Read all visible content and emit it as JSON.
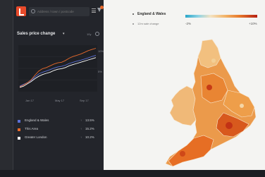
{
  "search": {
    "placeholder": "Address / town / postcode"
  },
  "panel": {
    "title": "Sales price change",
    "chevron": "▾",
    "range": "10y"
  },
  "chart_data": {
    "type": "line",
    "x": [
      0,
      1,
      2,
      3,
      4,
      5,
      6,
      7,
      8,
      9,
      10,
      11,
      12,
      13,
      14,
      15,
      16,
      17,
      18,
      19,
      20
    ],
    "x_tick_labels": [
      "Jan 17",
      "May 17",
      "Sep 17"
    ],
    "y_tick_labels": [
      "10%",
      "5%"
    ],
    "series": [
      {
        "name": "England & Wales",
        "color": "#5b6fd6",
        "values": [
          0.4,
          1.0,
          1.6,
          2.4,
          3.6,
          4.6,
          5.2,
          5.6,
          6.1,
          6.6,
          7.0,
          7.2,
          7.6,
          8.2,
          8.6,
          9.0,
          9.3,
          9.7,
          10.1,
          10.6,
          11.0
        ]
      },
      {
        "name": "This Area",
        "color": "#e8692a",
        "values": [
          0.2,
          0.8,
          1.6,
          2.6,
          4.2,
          5.6,
          6.4,
          6.8,
          7.4,
          8.0,
          8.4,
          8.6,
          9.2,
          10.0,
          10.6,
          11.0,
          11.4,
          12.0,
          12.6,
          13.0,
          13.4
        ]
      },
      {
        "name": "Greater London",
        "color": "#ffffff",
        "values": [
          0.0,
          0.4,
          1.2,
          2.0,
          3.0,
          3.8,
          4.4,
          4.8,
          5.2,
          5.8,
          6.2,
          6.4,
          6.8,
          7.4,
          7.8,
          8.2,
          8.6,
          9.0,
          9.4,
          9.8,
          10.2
        ]
      }
    ],
    "ylim": [
      -1,
      14
    ]
  },
  "legend": [
    {
      "name": "England & Wales",
      "arrow": "↑",
      "value": "13.5%",
      "color": "#5b6fd6"
    },
    {
      "name": "This Area",
      "arrow": "↑",
      "value": "15.2%",
      "color": "#e8692a"
    },
    {
      "name": "Greater London",
      "arrow": "↑",
      "value": "10.2%",
      "color": "#ffffff"
    }
  ],
  "map_legend": {
    "title": "England & Wales",
    "subtitle": "12m sale change",
    "min_label": "-2%",
    "max_label": "+10%"
  }
}
